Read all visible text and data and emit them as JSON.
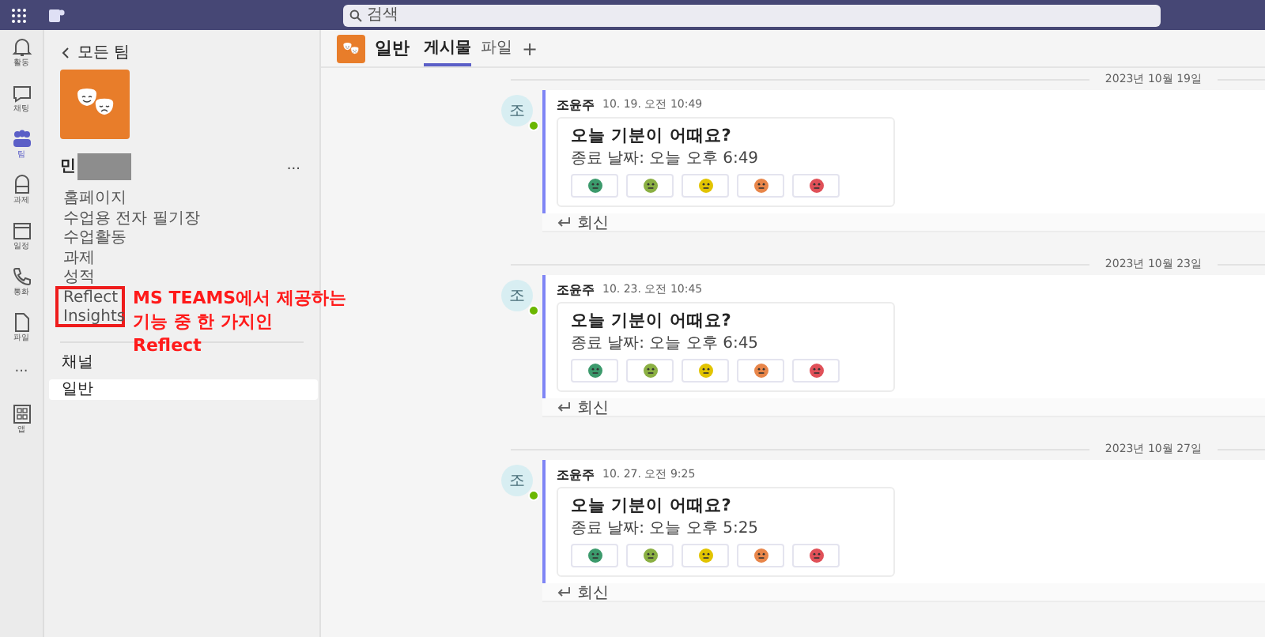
{
  "top_bar": {
    "search": {
      "placeholder": "검색"
    }
  },
  "rail": {
    "items": [
      {
        "kind": "bell",
        "label": "활동",
        "selected": false
      },
      {
        "kind": "chat",
        "label": "채팅",
        "selected": false
      },
      {
        "kind": "teams",
        "label": "팀",
        "selected": true
      },
      {
        "kind": "bag",
        "label": "과제",
        "selected": false
      },
      {
        "kind": "calendar",
        "label": "일정",
        "selected": false
      },
      {
        "kind": "phone",
        "label": "통화",
        "selected": false
      },
      {
        "kind": "file",
        "label": "파일",
        "selected": false
      },
      {
        "kind": "more",
        "label": "...",
        "selected": false
      },
      {
        "kind": "apps",
        "label": "앱",
        "selected": false
      }
    ]
  },
  "sidebar": {
    "back_link": "모든 팀",
    "team": {
      "name": "민",
      "redacted": true,
      "more": "...",
      "nav_items": [
        {
          "label": "홈페이지"
        },
        {
          "label": "수업용 전자 필기장"
        },
        {
          "label": "수업활동"
        },
        {
          "label": "과제"
        },
        {
          "label": "성적"
        },
        {
          "label": "Reflect"
        },
        {
          "label": "Insights"
        }
      ]
    },
    "channels_heading": "채널",
    "channels": [
      {
        "label": "일반",
        "selected": true
      }
    ]
  },
  "annotation": {
    "lines": [
      "MS TEAMS에서 제공하는",
      "기능 중 한 가지인",
      "Reflect"
    ]
  },
  "channel_header": {
    "name": "일반",
    "tabs": [
      {
        "label": "게시물",
        "selected": true
      },
      {
        "label": "파일",
        "selected": false
      }
    ],
    "add": "+"
  },
  "posts": [
    {
      "date": "2023년 10월 19일",
      "avatar": "조",
      "online": true,
      "author": "조윤주",
      "time": "10. 19. 오전 10:49",
      "title": "오늘 기분이 어때요?",
      "deadline": "종료 날짜: 오늘 오후 6:49",
      "reply": "회신",
      "moods": [
        {
          "color": "#3c9a6c"
        },
        {
          "color": "#8bb043"
        },
        {
          "color": "#e2c400"
        },
        {
          "color": "#e8864a"
        },
        {
          "color": "#e05058"
        }
      ]
    },
    {
      "date": "2023년 10월 23일",
      "avatar": "조",
      "online": true,
      "author": "조윤주",
      "time": "10. 23. 오전 10:45",
      "title": "오늘 기분이 어때요?",
      "deadline": "종료 날짜: 오늘 오후 6:45",
      "reply": "회신",
      "moods": [
        {
          "color": "#3c9a6c"
        },
        {
          "color": "#8bb043"
        },
        {
          "color": "#e2c400"
        },
        {
          "color": "#e8864a"
        },
        {
          "color": "#e05058"
        }
      ]
    },
    {
      "date": "2023년 10월 27일",
      "avatar": "조",
      "online": true,
      "author": "조윤주",
      "time": "10. 27. 오전 9:25",
      "title": "오늘 기분이 어때요?",
      "deadline": "종료 날짜: 오늘 오후 5:25",
      "reply": "회신",
      "moods": [
        {
          "color": "#3c9a6c"
        },
        {
          "color": "#8bb043"
        },
        {
          "color": "#e2c400"
        },
        {
          "color": "#e8864a"
        },
        {
          "color": "#e05058"
        }
      ]
    }
  ]
}
